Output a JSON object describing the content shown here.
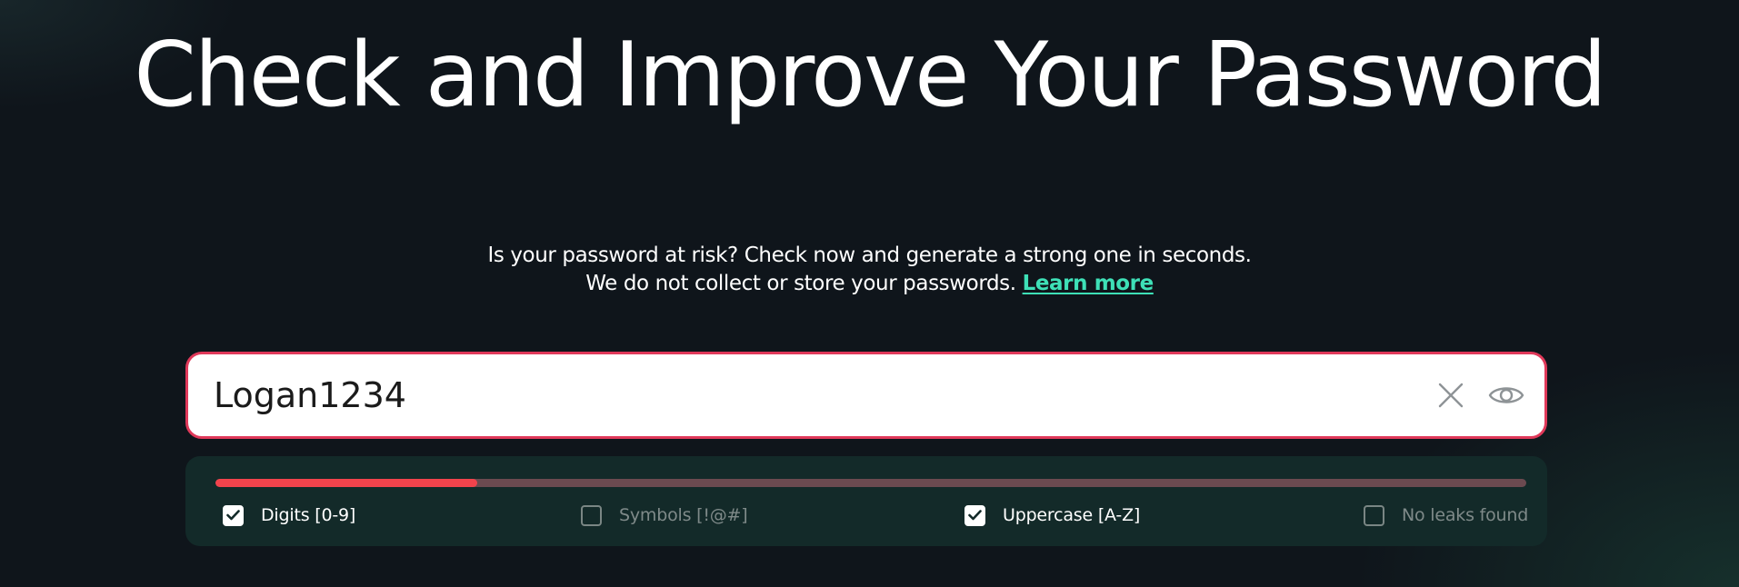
{
  "hero": {
    "title": "Check and Improve Your Password",
    "subtitle_line1": "Is your password at risk? Check now and generate a strong one in seconds.",
    "subtitle_line2": "We do not collect or store your passwords.",
    "learn_more": "Learn more"
  },
  "password_field": {
    "value": "Logan1234",
    "state_color": "#e0395a",
    "icons": [
      "close-icon",
      "eye-icon"
    ]
  },
  "strength": {
    "fill_fraction": 0.2,
    "fill_color": "#f2434c",
    "track_color": "#6b4a50",
    "criteria": [
      {
        "label": "Digits [0-9]",
        "checked": true
      },
      {
        "label": "Symbols [!@#]",
        "checked": false
      },
      {
        "label": "Uppercase [A-Z]",
        "checked": true
      },
      {
        "label": "No leaks found",
        "checked": false
      }
    ]
  },
  "colors": {
    "background": "#0f151b",
    "accent": "#3ee0b7",
    "panel": "#132a29"
  }
}
